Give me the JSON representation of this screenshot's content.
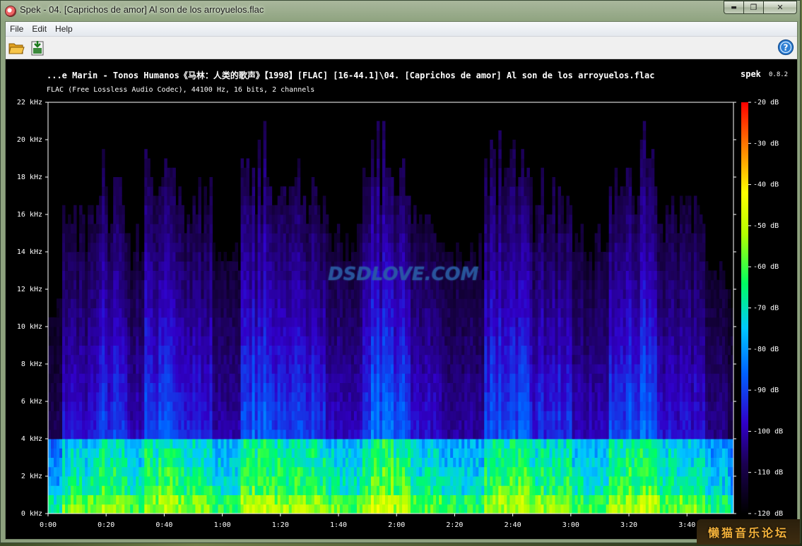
{
  "window": {
    "title": "Spek - 04. [Caprichos de amor] Al son de los arroyuelos.flac",
    "min_label": "▬",
    "max_label": "❐",
    "close_label": "✕"
  },
  "menu": {
    "items": [
      {
        "label": "File"
      },
      {
        "label": "Edit"
      },
      {
        "label": "Help"
      }
    ]
  },
  "toolbar": {
    "open_icon": "folder-open-icon",
    "save_icon": "save-image-icon",
    "help_icon": "help-icon"
  },
  "spectrogram": {
    "file_label": "...e Marin - Tonos Humanos《马林：人类的歌声》【1998】[FLAC] [16-44.1]\\04. [Caprichos de amor] Al son de los arroyuelos.flac",
    "app_name": "spek",
    "app_version": "0.8.2",
    "info": "FLAC (Free Lossless Audio Codec), 44100 Hz, 16 bits, 2 channels",
    "watermark": "DSDLOVE.COM"
  },
  "chart_data": {
    "type": "heatmap",
    "title": "",
    "xlabel": "",
    "ylabel": "",
    "x_unit": "time (m:ss)",
    "y_unit": "kHz",
    "xlim": [
      0,
      236
    ],
    "ylim": [
      0,
      22
    ],
    "x_ticks": [
      {
        "value": 0,
        "label": "0:00"
      },
      {
        "value": 20,
        "label": "0:20"
      },
      {
        "value": 40,
        "label": "0:40"
      },
      {
        "value": 60,
        "label": "1:00"
      },
      {
        "value": 80,
        "label": "1:20"
      },
      {
        "value": 100,
        "label": "1:40"
      },
      {
        "value": 120,
        "label": "2:00"
      },
      {
        "value": 140,
        "label": "2:20"
      },
      {
        "value": 160,
        "label": "2:40"
      },
      {
        "value": 180,
        "label": "3:00"
      },
      {
        "value": 200,
        "label": "3:20"
      },
      {
        "value": 220,
        "label": "3:40"
      }
    ],
    "y_ticks": [
      {
        "value": 0,
        "label": "0 kHz"
      },
      {
        "value": 2,
        "label": "2 kHz"
      },
      {
        "value": 4,
        "label": "4 kHz"
      },
      {
        "value": 6,
        "label": "6 kHz"
      },
      {
        "value": 8,
        "label": "8 kHz"
      },
      {
        "value": 10,
        "label": "10 kHz"
      },
      {
        "value": 12,
        "label": "12 kHz"
      },
      {
        "value": 14,
        "label": "14 kHz"
      },
      {
        "value": 16,
        "label": "16 kHz"
      },
      {
        "value": 18,
        "label": "18 kHz"
      },
      {
        "value": 20,
        "label": "20 kHz"
      },
      {
        "value": 22,
        "label": "22 kHz"
      }
    ],
    "colorbar": {
      "range_db": [
        -120,
        -20
      ],
      "ticks": [
        {
          "value": -20,
          "label": "-20 dB"
        },
        {
          "value": -30,
          "label": "-30 dB"
        },
        {
          "value": -40,
          "label": "-40 dB"
        },
        {
          "value": -50,
          "label": "-50 dB"
        },
        {
          "value": -60,
          "label": "-60 dB"
        },
        {
          "value": -70,
          "label": "-70 dB"
        },
        {
          "value": -80,
          "label": "-80 dB"
        },
        {
          "value": -90,
          "label": "-90 dB"
        },
        {
          "value": -100,
          "label": "-100 dB"
        },
        {
          "value": -110,
          "label": "-110 dB"
        },
        {
          "value": -120,
          "label": "-120 dB"
        }
      ],
      "colors": [
        "#000000",
        "#1a0050",
        "#3000c8",
        "#0060ff",
        "#00c8ff",
        "#00ff60",
        "#b4ff00",
        "#ffff00",
        "#ff8000",
        "#ff0000"
      ]
    },
    "segments": [
      {
        "start": 5,
        "end": 15,
        "level": 0.55
      },
      {
        "start": 15,
        "end": 27,
        "level": 0.75
      },
      {
        "start": 27,
        "end": 33,
        "level": 0.45
      },
      {
        "start": 33,
        "end": 47,
        "level": 0.85
      },
      {
        "start": 47,
        "end": 57,
        "level": 0.65
      },
      {
        "start": 57,
        "end": 66,
        "level": 0.35
      },
      {
        "start": 66,
        "end": 80,
        "level": 0.9
      },
      {
        "start": 80,
        "end": 96,
        "level": 0.75
      },
      {
        "start": 96,
        "end": 108,
        "level": 0.45
      },
      {
        "start": 108,
        "end": 125,
        "level": 0.95
      },
      {
        "start": 125,
        "end": 136,
        "level": 0.55
      },
      {
        "start": 136,
        "end": 150,
        "level": 0.35
      },
      {
        "start": 150,
        "end": 167,
        "level": 0.85
      },
      {
        "start": 167,
        "end": 180,
        "level": 0.7
      },
      {
        "start": 180,
        "end": 193,
        "level": 0.45
      },
      {
        "start": 193,
        "end": 210,
        "level": 0.9
      },
      {
        "start": 210,
        "end": 226,
        "level": 0.55
      },
      {
        "start": 226,
        "end": 234,
        "level": 0.25
      }
    ],
    "content_band_khz": 4,
    "max_energy_khz": 21
  },
  "forum_badge": "懒猫音乐论坛"
}
